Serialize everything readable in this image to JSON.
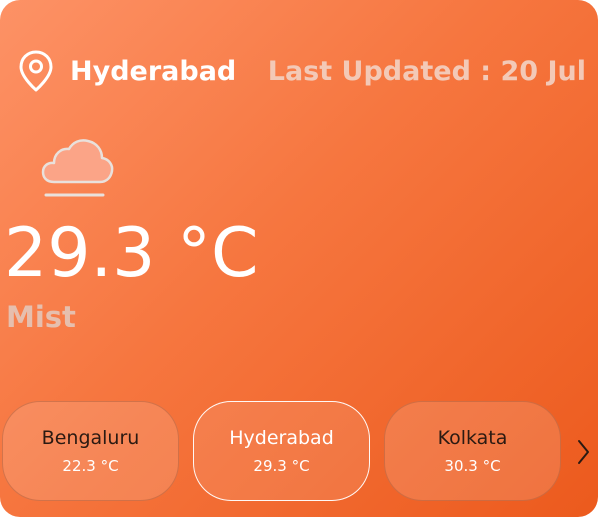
{
  "location": {
    "city": "Hyderabad",
    "last_updated": "Last Updated : 20 Jul",
    "icon": "location-pin-icon"
  },
  "current": {
    "temperature": "29.3 °C",
    "condition": "Mist",
    "icon": "cloud-mist-icon"
  },
  "cities": [
    {
      "name": "Bengaluru",
      "temp": "22.3 °C",
      "selected": false
    },
    {
      "name": "Hyderabad",
      "temp": "29.3 °C",
      "selected": true
    },
    {
      "name": "Kolkata",
      "temp": "30.3 °C",
      "selected": false
    }
  ],
  "navigation": {
    "next_icon": "chevron-right-icon"
  },
  "colors": {
    "gradient_start": "#fd9266",
    "gradient_end": "#ec5a1d",
    "muted_text": "#f3c9b7"
  }
}
